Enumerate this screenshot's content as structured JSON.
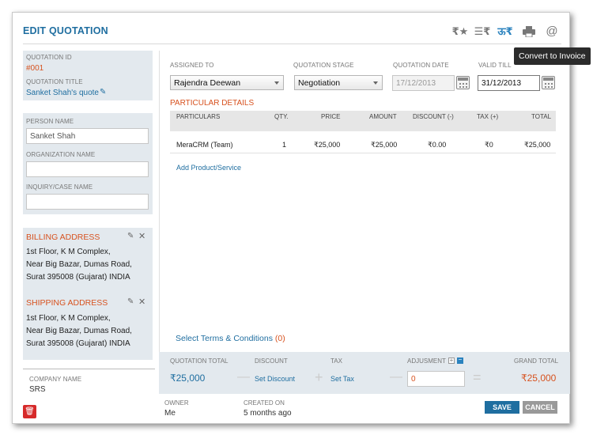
{
  "header": {
    "title": "EDIT QUOTATION",
    "tooltip": "Convert to Invoice",
    "icons": [
      "rupee-star-icon",
      "rupee-sort-icon",
      "convert-invoice-icon",
      "print-icon",
      "email-at-icon"
    ],
    "at_symbol": "@"
  },
  "left": {
    "quotation_id_label": "QUOTATION ID",
    "quotation_id": "#001",
    "quotation_title_label": "QUOTATION TITLE",
    "quotation_title": "Sanket Shah's quote",
    "person_name_label": "PERSON NAME",
    "person_name": "Sanket Shah",
    "organization_name_label": "ORGANIZATION NAME",
    "organization_name": "",
    "inquiry_label": "INQUIRY/CASE NAME",
    "inquiry": "",
    "billing_label": "BILLING ADDRESS",
    "billing_lines": [
      "1st Floor, K M Complex,",
      "Near Big Bazar, Dumas Road,",
      "Surat 395008 (Gujarat) INDIA"
    ],
    "shipping_label": "SHIPPING ADDRESS",
    "shipping_lines": [
      "1st Floor, K M Complex,",
      "Near Big Bazar, Dumas Road,",
      "Surat 395008 (Gujarat) INDIA"
    ],
    "company_name_label": "COMPANY NAME",
    "company_name": "SRS"
  },
  "form": {
    "assigned_to_label": "ASSIGNED TO",
    "assigned_to": "Rajendra Deewan",
    "stage_label": "QUOTATION STAGE",
    "stage": "Negotiation",
    "date_label": "QUOTATION DATE",
    "date": "17/12/2013",
    "valid_label": "VALID TILL",
    "valid": "31/12/2013"
  },
  "particulars": {
    "section_title": "PARTICULAR DETAILS",
    "headers": [
      "PARTICULARS",
      "QTY.",
      "PRICE",
      "AMOUNT",
      "DISCOUNT (-)",
      "TAX (+)",
      "TOTAL"
    ],
    "row": [
      "MeraCRM (Team)",
      "1",
      "₹25,000",
      "₹25,000",
      "₹0.00",
      "₹0",
      "₹25,000"
    ],
    "add_link": "Add Product/Service"
  },
  "terms": {
    "label": "Select Terms & Conditions",
    "count": "(0)"
  },
  "totals": {
    "quotation_total_label": "QUOTATION TOTAL",
    "quotation_total": "₹25,000",
    "discount_label": "DISCOUNT",
    "discount_link": "Set Discount",
    "tax_label": "TAX",
    "tax_link": "Set Tax",
    "adjustment_label": "ADJUSMENT",
    "adjustment": "0",
    "grand_total_label": "GRAND TOTAL",
    "grand_total": "₹25,000",
    "minus": "—",
    "plus": "+",
    "equals": "="
  },
  "footer": {
    "owner_label": "OWNER",
    "owner": "Me",
    "created_label": "CREATED ON",
    "created": "5 months ago",
    "save": "SAVE",
    "cancel": "CANCEL"
  }
}
